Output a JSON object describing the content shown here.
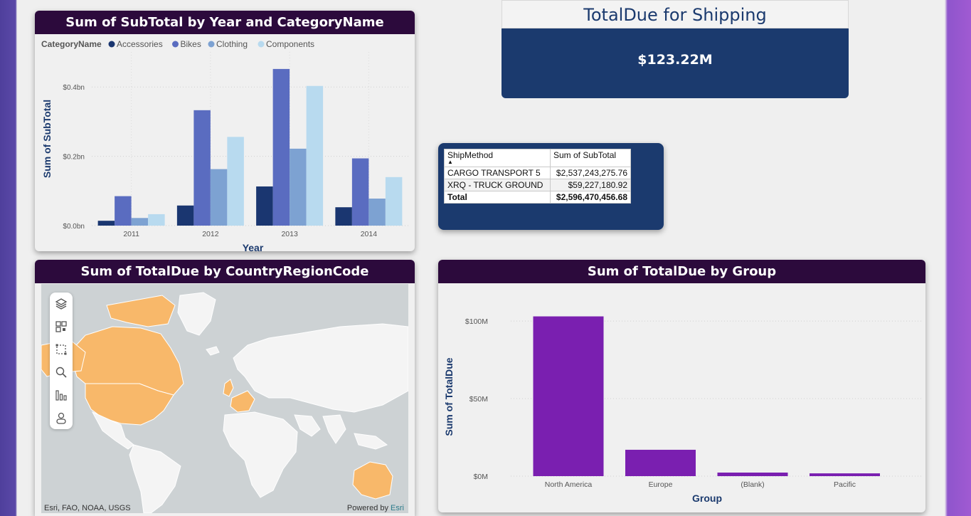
{
  "kpi": {
    "title": "TotalDue for Shipping",
    "value": "$123.22M"
  },
  "ship_table": {
    "headers": [
      "ShipMethod",
      "Sum of SubTotal"
    ],
    "rows": [
      {
        "method": "CARGO TRANSPORT 5",
        "subtotal": "$2,537,243,275.76"
      },
      {
        "method": "XRQ - TRUCK GROUND",
        "subtotal": "$59,227,180.92"
      }
    ],
    "total": {
      "label": "Total",
      "subtotal": "$2,596,470,456.68"
    }
  },
  "map": {
    "title": "Sum of TotalDue by CountryRegionCode",
    "attribution": "Esri, FAO, NOAA, USGS",
    "powered_by": "Powered by",
    "powered_by_brand": "Esri",
    "highlight_color": "#f8b86a",
    "tools": [
      "layers-icon",
      "qr-grid-icon",
      "select-box-icon",
      "search-icon",
      "bar-chart-icon",
      "person-icon"
    ]
  },
  "chart_data": [
    {
      "type": "bar",
      "title": "Sum of SubTotal by Year and CategoryName",
      "legend_title": "CategoryName",
      "legend_position": "top-left",
      "xlabel": "Year",
      "ylabel": "Sum of SubTotal",
      "categories": [
        "2011",
        "2012",
        "2013",
        "2014"
      ],
      "yticks": [
        0,
        0.2,
        0.4
      ],
      "ytick_labels": [
        "$0.0bn",
        "$0.2bn",
        "$0.4bn"
      ],
      "ylim": [
        0,
        0.46
      ],
      "grid": true,
      "series": [
        {
          "name": "Accessories",
          "color": "#1a3670",
          "values": [
            0.014,
            0.058,
            0.113,
            0.053
          ]
        },
        {
          "name": "Bikes",
          "color": "#5a6cc0",
          "values": [
            0.085,
            0.333,
            0.452,
            0.194
          ]
        },
        {
          "name": "Clothing",
          "color": "#7da2d2",
          "values": [
            0.022,
            0.163,
            0.222,
            0.078
          ]
        },
        {
          "name": "Components",
          "color": "#b8daef",
          "values": [
            0.033,
            0.256,
            0.403,
            0.14
          ]
        }
      ]
    },
    {
      "type": "bar",
      "title": "Sum of TotalDue by Group",
      "xlabel": "Group",
      "ylabel": "Sum of TotalDue",
      "categories": [
        "North America",
        "Europe",
        "(Blank)",
        "Pacific"
      ],
      "values": [
        103,
        17,
        2.3,
        1.8
      ],
      "color": "#7a1fb0",
      "yticks": [
        0,
        50,
        100
      ],
      "ytick_labels": [
        "$0M",
        "$50M",
        "$100M"
      ],
      "ylim": [
        0,
        106
      ],
      "grid": true
    }
  ]
}
